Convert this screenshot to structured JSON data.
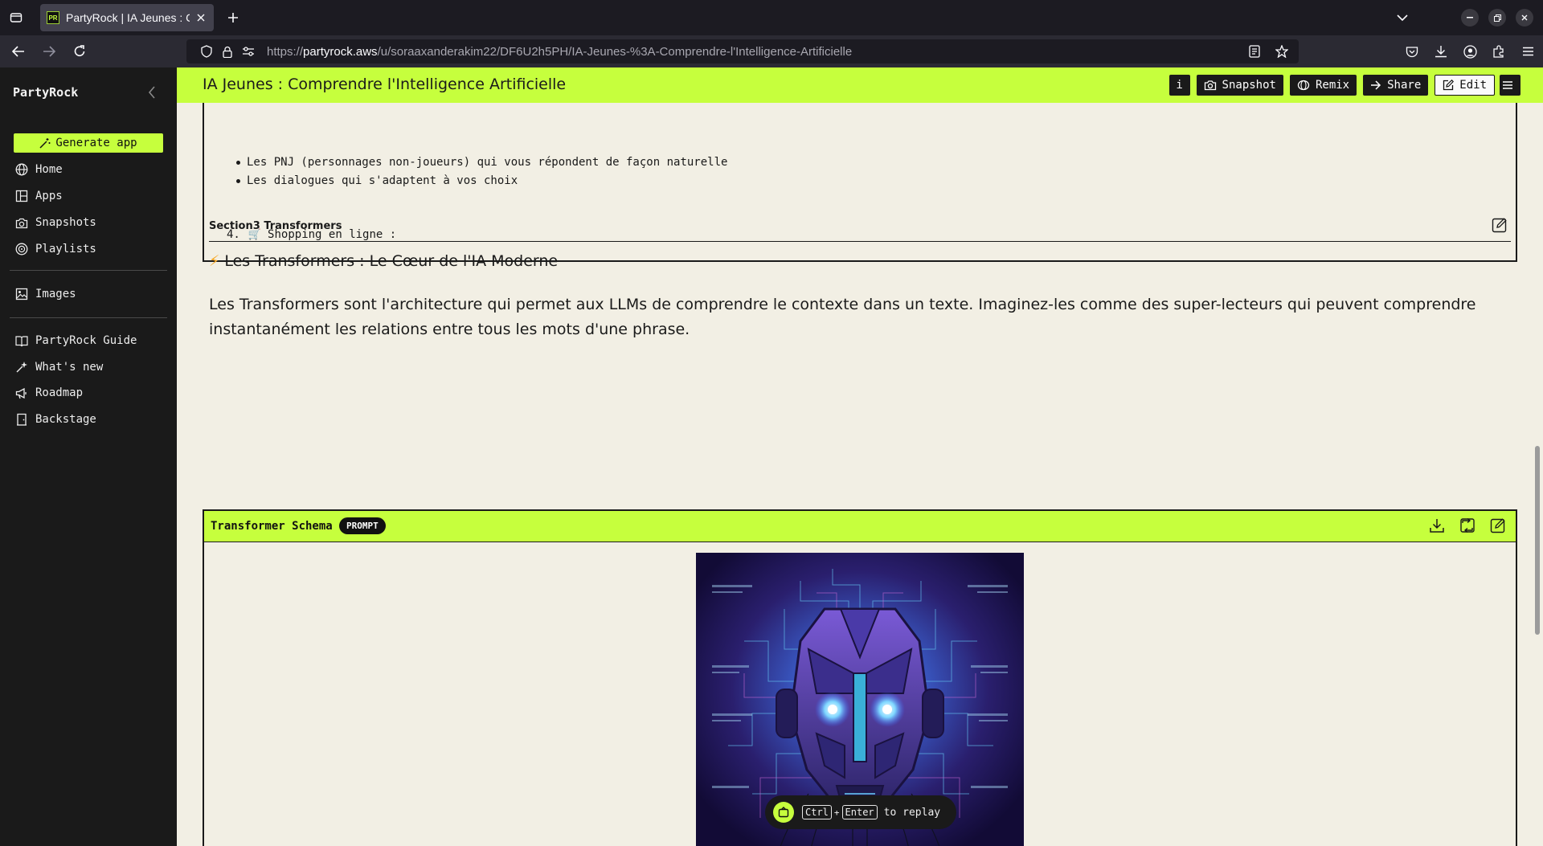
{
  "browser": {
    "tab_title": "PartyRock | IA Jeunes : Co",
    "favicon_text": "PR",
    "url_prefix": "https://",
    "url_domain": "partyrock.aws",
    "url_path": "/u/soraaxanderakim22/DF6U2h5PH/IA-Jeunes-%3A-Comprendre-l'Intelligence-Artificielle"
  },
  "sidebar": {
    "brand": "PartyRock",
    "generate_label": "Generate app",
    "items": [
      {
        "label": "Home",
        "icon": "globe-icon"
      },
      {
        "label": "Apps",
        "icon": "apps-grid-icon"
      },
      {
        "label": "Snapshots",
        "icon": "camera-icon"
      },
      {
        "label": "Playlists",
        "icon": "playlist-icon"
      },
      {
        "label": "Images",
        "icon": "images-icon"
      },
      {
        "label": "PartyRock Guide",
        "icon": "book-icon"
      },
      {
        "label": "What's new",
        "icon": "sparkle-icon"
      },
      {
        "label": "Roadmap",
        "icon": "megaphone-icon"
      },
      {
        "label": "Backstage",
        "icon": "door-icon"
      }
    ]
  },
  "header": {
    "title": "IA Jeunes : Comprendre l'Intelligence Artificielle",
    "info_label": "i",
    "snapshot_label": "Snapshot",
    "remix_label": "Remix",
    "share_label": "Share",
    "edit_label": "Edit"
  },
  "card_top": {
    "bullets": [
      "Les PNJ (personnages non-joueurs) qui vous répondent de façon naturelle",
      "Les dialogues qui s'adaptent à vos choix"
    ],
    "numbered_index": "4.",
    "numbered_icon": "🛒",
    "numbered_text": "Shopping en ligne :"
  },
  "section3": {
    "label": "Section3 Transformers",
    "heading_icon": "⚡",
    "heading": "Les Transformers : Le Cœur de l'IA Moderne",
    "body": "Les Transformers sont l'architecture qui permet aux LLMs de comprendre le contexte dans un texte. Imaginez-les comme des super-lecteurs qui peuvent comprendre instantanément les relations entre tous les mots d'une phrase."
  },
  "transformer_card": {
    "title": "Transformer Schema",
    "badge": "PROMPT"
  },
  "replay": {
    "key1": "Ctrl",
    "plus": "+",
    "key2": "Enter",
    "text": "to replay"
  },
  "colors": {
    "accent": "#c6ff3d",
    "sidebar_bg": "#1a1a1a",
    "page_bg": "#f2efe4"
  }
}
